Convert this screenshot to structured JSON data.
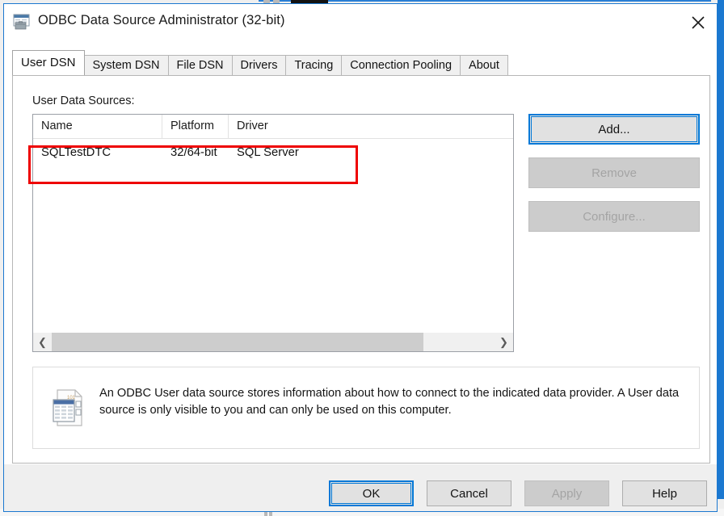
{
  "window": {
    "title": "ODBC Data Source Administrator (32-bit)",
    "icon": "odbc-administrator-icon",
    "close_label": "close-icon",
    "accent_color": "#0078d7",
    "border_color": "#1b78d0"
  },
  "tabs": [
    {
      "label": "User DSN",
      "active": true
    },
    {
      "label": "System DSN",
      "active": false
    },
    {
      "label": "File DSN",
      "active": false
    },
    {
      "label": "Drivers",
      "active": false
    },
    {
      "label": "Tracing",
      "active": false
    },
    {
      "label": "Connection Pooling",
      "active": false
    },
    {
      "label": "About",
      "active": false
    }
  ],
  "page": {
    "section_label": "User Data Sources:",
    "list": {
      "columns": [
        "Name",
        "Platform",
        "Driver"
      ],
      "rows": [
        {
          "name": "SQLTestDTC",
          "platform": "32/64-bit",
          "driver": "SQL Server"
        }
      ],
      "scroll_left_icon": "chevron-left-icon",
      "scroll_right_icon": "chevron-right-icon"
    },
    "side_buttons": [
      {
        "label": "Add...",
        "enabled": true,
        "focused": true
      },
      {
        "label": "Remove",
        "enabled": false,
        "focused": false
      },
      {
        "label": "Configure...",
        "enabled": false,
        "focused": false
      }
    ],
    "info": {
      "icon": "data-source-document-icon",
      "text": "An ODBC User data source stores information about how to connect to the indicated data provider.   A User data source is only visible to you and can only be used on this computer."
    }
  },
  "footer_buttons": [
    {
      "label": "OK",
      "enabled": true,
      "focused": true
    },
    {
      "label": "Cancel",
      "enabled": true,
      "focused": false
    },
    {
      "label": "Apply",
      "enabled": false,
      "focused": false
    },
    {
      "label": "Help",
      "enabled": true,
      "focused": false
    }
  ],
  "annotation": {
    "color": "#ee0000",
    "target": "SQLTestDTC"
  }
}
